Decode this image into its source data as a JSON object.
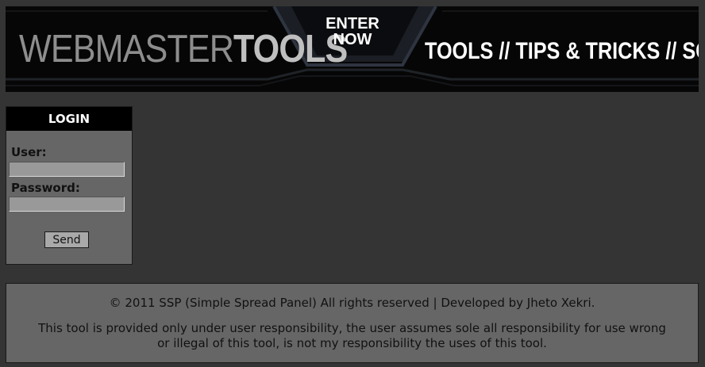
{
  "banner": {
    "brand_light": "WEBMASTER",
    "brand_bold": "TOOLS",
    "enter_line1": "ENTER",
    "enter_line2": "NOW",
    "tagline": "TOOLS // TIPS & TRICKS // SCRIPTS"
  },
  "login": {
    "title": "LOGIN",
    "user_label": "User:",
    "user_value": "",
    "password_label": "Password:",
    "password_value": "",
    "send_label": "Send"
  },
  "footer": {
    "copyright": "© 2011 SSP (Simple Spread Panel) All rights reserved | Developed by Jheto Xekri.",
    "disclaimer": "This tool is provided only under user responsibility, the user assumes sole all responsibility for use wrong or illegal of this tool, is not my responsibility the uses of this tool."
  }
}
